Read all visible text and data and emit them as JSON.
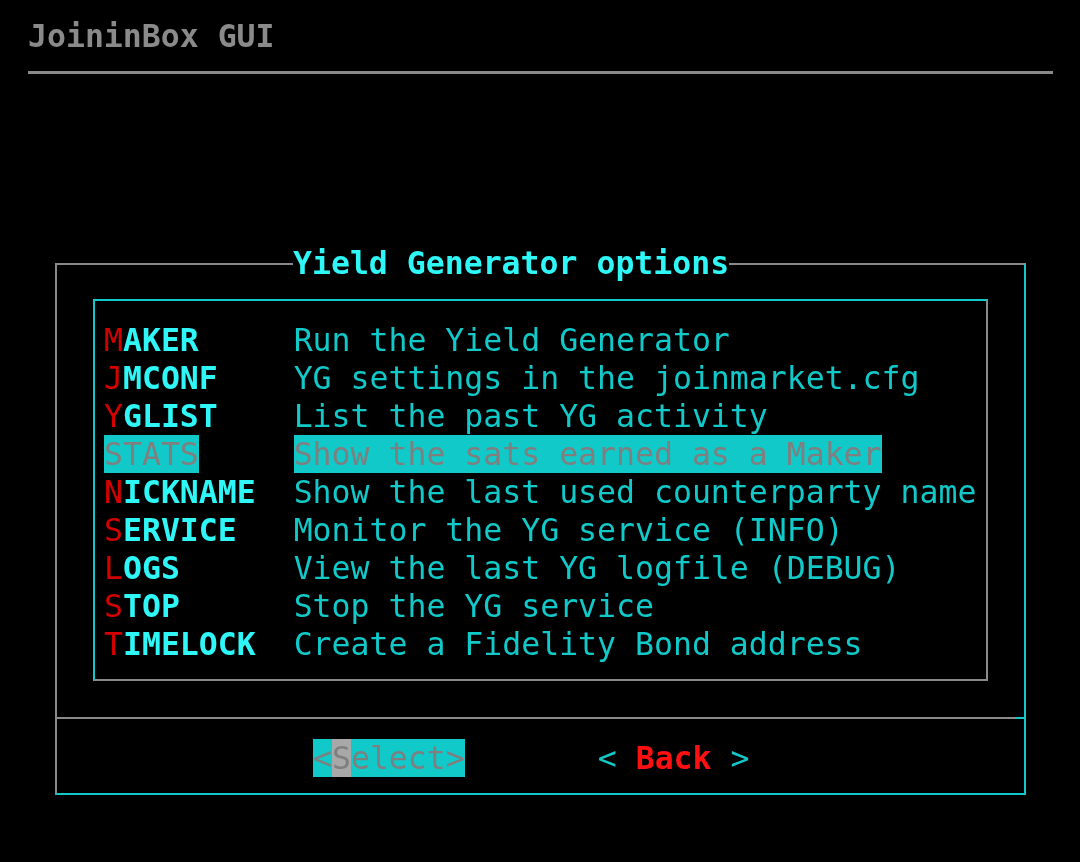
{
  "screen": {
    "title": "JoininBox GUI"
  },
  "dialog": {
    "title": "Yield Generator options",
    "menu": [
      {
        "tag": "MAKER",
        "description": "Run the Yield Generator",
        "selected": false
      },
      {
        "tag": "JMCONF",
        "description": "YG settings in the joinmarket.cfg",
        "selected": false
      },
      {
        "tag": "YGLIST",
        "description": "List the past YG activity",
        "selected": false
      },
      {
        "tag": "STATS",
        "description": "Show the sats earned as a Maker",
        "selected": true
      },
      {
        "tag": "NICKNAME",
        "description": "Show the last used counterparty name",
        "selected": false
      },
      {
        "tag": "SERVICE",
        "description": "Monitor the YG service (INFO)",
        "selected": false
      },
      {
        "tag": "LOGS",
        "description": "View the last YG logfile (DEBUG)",
        "selected": false
      },
      {
        "tag": "STOP",
        "description": "Stop the YG service",
        "selected": false
      },
      {
        "tag": "TIMELOCK",
        "description": "Create a Fidelity Bond address",
        "selected": false
      }
    ],
    "buttons": [
      {
        "left": "<",
        "label": "Select",
        "right": ">",
        "selected": true
      },
      {
        "left": "<",
        "label": "Back",
        "right": ">",
        "selected": false
      }
    ]
  }
}
